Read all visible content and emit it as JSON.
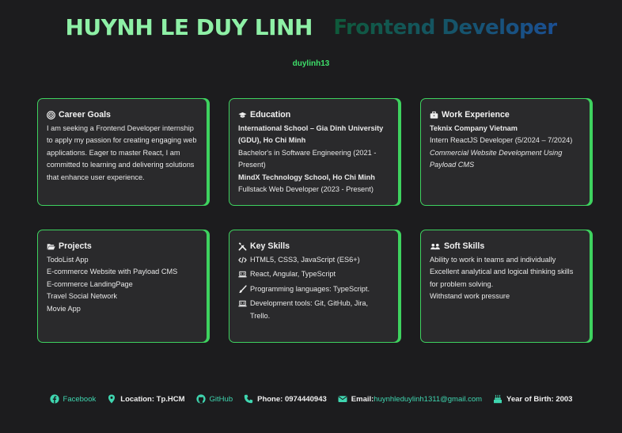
{
  "header": {
    "name": "HUYNH LE DUY LINH",
    "role": "Frontend Developer",
    "username": "duylinh13"
  },
  "career": {
    "title": "Career Goals",
    "icon": "bullseye-icon",
    "text": "I am seeking a Frontend Developer internship to apply my passion for creating engaging web applications. Eager to master React, I am committed to learning and delivering solutions that enhance user experience."
  },
  "education": {
    "title": "Education",
    "icon": "graduation-cap-icon",
    "school1": "International School – Gia Dinh University (GDU), Ho Chi Minh",
    "degree1": "Bachelor's in Software Engineering (2021 - Present)",
    "school2": "MindX Technology School, Ho Chi Minh",
    "degree2": "Fullstack Web Developer (2023 - Present)"
  },
  "experience": {
    "title": "Work Experience",
    "icon": "briefcase-icon",
    "company": "Teknix Company Vietnam",
    "position": "Intern ReactJS Developer (5/2024 – 7/2024)",
    "project": "Commercial Website Development Using Payload CMS"
  },
  "projects": {
    "title": "Projects",
    "icon": "folder-open-icon",
    "items": [
      "TodoList App",
      "E-commerce Website with Payload CMS",
      "E-commerce LandingPage",
      "Travel Social Network",
      "Movie App"
    ]
  },
  "skills": {
    "title": "Key Skills",
    "icon": "tools-icon",
    "items": [
      {
        "icon": "code-icon",
        "text": "HTML5, CSS3, JavaScript (ES6+)"
      },
      {
        "icon": "laptop-code-icon",
        "text": "React, Angular, TypeScript"
      },
      {
        "icon": "brush-icon",
        "text": "Programming languages: TypeScript."
      },
      {
        "icon": "laptop-code-icon",
        "text": "Development tools: Git, GitHub, Jira, Trello."
      }
    ]
  },
  "soft": {
    "title": "Soft Skills",
    "icon": "users-icon",
    "items": [
      "Ability to work in teams and individually",
      "Excellent analytical and logical thinking skills for problem solving.",
      "Withstand work pressure"
    ]
  },
  "footer": {
    "facebook": "Facebook",
    "location": "Location: Tp.HCM",
    "github": "GitHub",
    "phone": "Phone: 0974440943",
    "email_label": "Email:",
    "email": "huynhleduylinh1311@gmail.com",
    "birth": "Year of Birth: 2003"
  },
  "colors": {
    "background": "#1c1c1e",
    "card": "#2a2a2c",
    "accent_green": "#3ed25f",
    "name_green": "#8ef0a6",
    "link_teal": "#3fd6b0"
  }
}
